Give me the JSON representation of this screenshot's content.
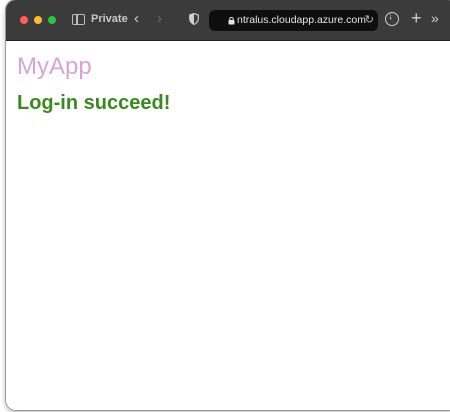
{
  "browser": {
    "private_label": "Private",
    "url": "ntralus.cloudapp.azure.com",
    "back_icon": "chevron-left-icon",
    "forward_icon": "chevron-right-icon",
    "reload_glyph": "↻",
    "new_tab_glyph": "+",
    "more_glyph": "»"
  },
  "page": {
    "brand": "MyApp",
    "message": "Log-in succeed!"
  },
  "colors": {
    "brand": "#d6a4d8",
    "message": "#3a8a1f",
    "toolbar": "#3b3b3b",
    "address_bar": "#0e0e0e"
  }
}
